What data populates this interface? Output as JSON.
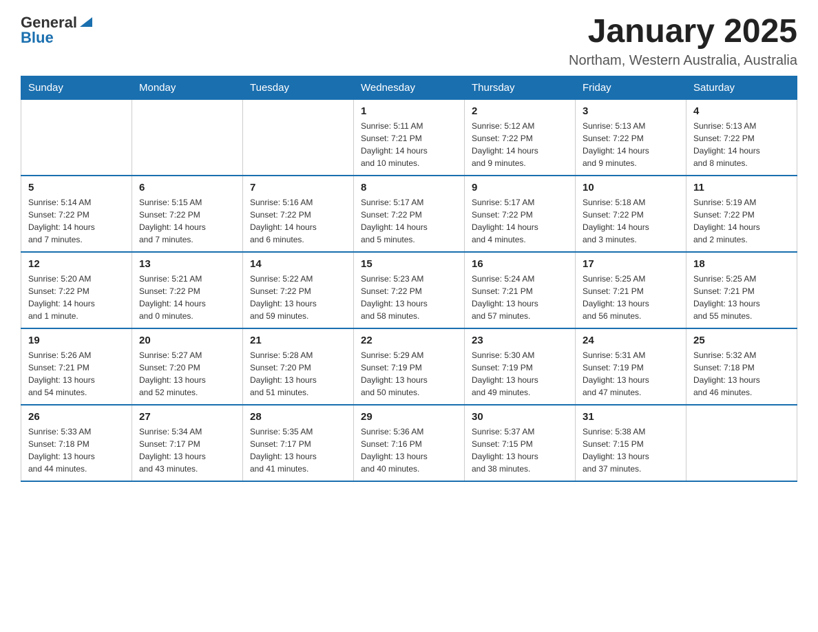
{
  "header": {
    "logo_general": "General",
    "logo_blue": "Blue",
    "month_title": "January 2025",
    "location": "Northam, Western Australia, Australia"
  },
  "weekdays": [
    "Sunday",
    "Monday",
    "Tuesday",
    "Wednesday",
    "Thursday",
    "Friday",
    "Saturday"
  ],
  "weeks": [
    [
      {
        "day": "",
        "info": ""
      },
      {
        "day": "",
        "info": ""
      },
      {
        "day": "",
        "info": ""
      },
      {
        "day": "1",
        "info": "Sunrise: 5:11 AM\nSunset: 7:21 PM\nDaylight: 14 hours\nand 10 minutes."
      },
      {
        "day": "2",
        "info": "Sunrise: 5:12 AM\nSunset: 7:22 PM\nDaylight: 14 hours\nand 9 minutes."
      },
      {
        "day": "3",
        "info": "Sunrise: 5:13 AM\nSunset: 7:22 PM\nDaylight: 14 hours\nand 9 minutes."
      },
      {
        "day": "4",
        "info": "Sunrise: 5:13 AM\nSunset: 7:22 PM\nDaylight: 14 hours\nand 8 minutes."
      }
    ],
    [
      {
        "day": "5",
        "info": "Sunrise: 5:14 AM\nSunset: 7:22 PM\nDaylight: 14 hours\nand 7 minutes."
      },
      {
        "day": "6",
        "info": "Sunrise: 5:15 AM\nSunset: 7:22 PM\nDaylight: 14 hours\nand 7 minutes."
      },
      {
        "day": "7",
        "info": "Sunrise: 5:16 AM\nSunset: 7:22 PM\nDaylight: 14 hours\nand 6 minutes."
      },
      {
        "day": "8",
        "info": "Sunrise: 5:17 AM\nSunset: 7:22 PM\nDaylight: 14 hours\nand 5 minutes."
      },
      {
        "day": "9",
        "info": "Sunrise: 5:17 AM\nSunset: 7:22 PM\nDaylight: 14 hours\nand 4 minutes."
      },
      {
        "day": "10",
        "info": "Sunrise: 5:18 AM\nSunset: 7:22 PM\nDaylight: 14 hours\nand 3 minutes."
      },
      {
        "day": "11",
        "info": "Sunrise: 5:19 AM\nSunset: 7:22 PM\nDaylight: 14 hours\nand 2 minutes."
      }
    ],
    [
      {
        "day": "12",
        "info": "Sunrise: 5:20 AM\nSunset: 7:22 PM\nDaylight: 14 hours\nand 1 minute."
      },
      {
        "day": "13",
        "info": "Sunrise: 5:21 AM\nSunset: 7:22 PM\nDaylight: 14 hours\nand 0 minutes."
      },
      {
        "day": "14",
        "info": "Sunrise: 5:22 AM\nSunset: 7:22 PM\nDaylight: 13 hours\nand 59 minutes."
      },
      {
        "day": "15",
        "info": "Sunrise: 5:23 AM\nSunset: 7:22 PM\nDaylight: 13 hours\nand 58 minutes."
      },
      {
        "day": "16",
        "info": "Sunrise: 5:24 AM\nSunset: 7:21 PM\nDaylight: 13 hours\nand 57 minutes."
      },
      {
        "day": "17",
        "info": "Sunrise: 5:25 AM\nSunset: 7:21 PM\nDaylight: 13 hours\nand 56 minutes."
      },
      {
        "day": "18",
        "info": "Sunrise: 5:25 AM\nSunset: 7:21 PM\nDaylight: 13 hours\nand 55 minutes."
      }
    ],
    [
      {
        "day": "19",
        "info": "Sunrise: 5:26 AM\nSunset: 7:21 PM\nDaylight: 13 hours\nand 54 minutes."
      },
      {
        "day": "20",
        "info": "Sunrise: 5:27 AM\nSunset: 7:20 PM\nDaylight: 13 hours\nand 52 minutes."
      },
      {
        "day": "21",
        "info": "Sunrise: 5:28 AM\nSunset: 7:20 PM\nDaylight: 13 hours\nand 51 minutes."
      },
      {
        "day": "22",
        "info": "Sunrise: 5:29 AM\nSunset: 7:19 PM\nDaylight: 13 hours\nand 50 minutes."
      },
      {
        "day": "23",
        "info": "Sunrise: 5:30 AM\nSunset: 7:19 PM\nDaylight: 13 hours\nand 49 minutes."
      },
      {
        "day": "24",
        "info": "Sunrise: 5:31 AM\nSunset: 7:19 PM\nDaylight: 13 hours\nand 47 minutes."
      },
      {
        "day": "25",
        "info": "Sunrise: 5:32 AM\nSunset: 7:18 PM\nDaylight: 13 hours\nand 46 minutes."
      }
    ],
    [
      {
        "day": "26",
        "info": "Sunrise: 5:33 AM\nSunset: 7:18 PM\nDaylight: 13 hours\nand 44 minutes."
      },
      {
        "day": "27",
        "info": "Sunrise: 5:34 AM\nSunset: 7:17 PM\nDaylight: 13 hours\nand 43 minutes."
      },
      {
        "day": "28",
        "info": "Sunrise: 5:35 AM\nSunset: 7:17 PM\nDaylight: 13 hours\nand 41 minutes."
      },
      {
        "day": "29",
        "info": "Sunrise: 5:36 AM\nSunset: 7:16 PM\nDaylight: 13 hours\nand 40 minutes."
      },
      {
        "day": "30",
        "info": "Sunrise: 5:37 AM\nSunset: 7:15 PM\nDaylight: 13 hours\nand 38 minutes."
      },
      {
        "day": "31",
        "info": "Sunrise: 5:38 AM\nSunset: 7:15 PM\nDaylight: 13 hours\nand 37 minutes."
      },
      {
        "day": "",
        "info": ""
      }
    ]
  ]
}
